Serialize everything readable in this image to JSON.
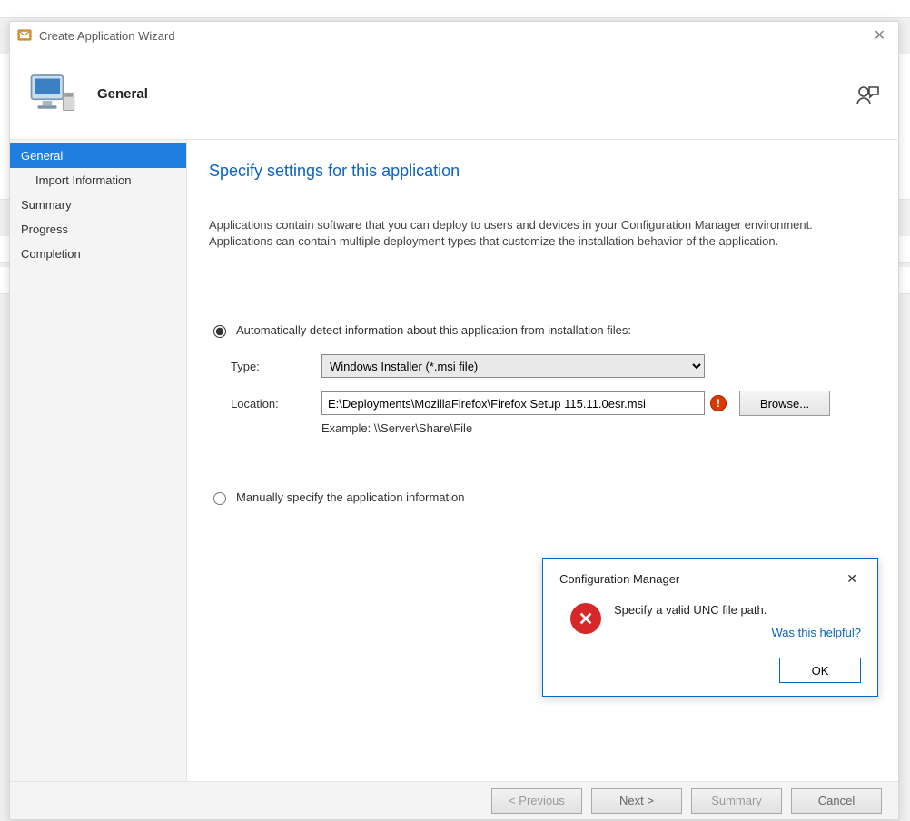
{
  "window": {
    "title": "Create Application Wizard"
  },
  "header": {
    "page_title": "General"
  },
  "sidebar": {
    "items": [
      {
        "label": "General",
        "selected": true
      },
      {
        "label": "Import Information"
      },
      {
        "label": "Summary"
      },
      {
        "label": "Progress"
      },
      {
        "label": "Completion"
      }
    ]
  },
  "content": {
    "heading": "Specify settings for this application",
    "description": "Applications contain software that you can deploy to users and devices in your Configuration Manager environment. Applications can contain multiple deployment types that customize the installation behavior of the application.",
    "radio_auto_label": "Automatically detect information about this application from installation files:",
    "type_label": "Type:",
    "type_value": "Windows Installer (*.msi file)",
    "location_label": "Location:",
    "location_value": "E:\\Deployments\\MozillaFirefox\\Firefox Setup 115.11.0esr.msi",
    "example_text": "Example: \\\\Server\\Share\\File",
    "browse_label": "Browse...",
    "radio_manual_label": "Manually specify the application information"
  },
  "dialog": {
    "title": "Configuration Manager",
    "message": "Specify a valid UNC file path.",
    "helpful_link": "Was this helpful?",
    "ok_label": "OK"
  },
  "footer": {
    "previous": "< Previous",
    "next": "Next >",
    "summary": "Summary",
    "cancel": "Cancel"
  }
}
